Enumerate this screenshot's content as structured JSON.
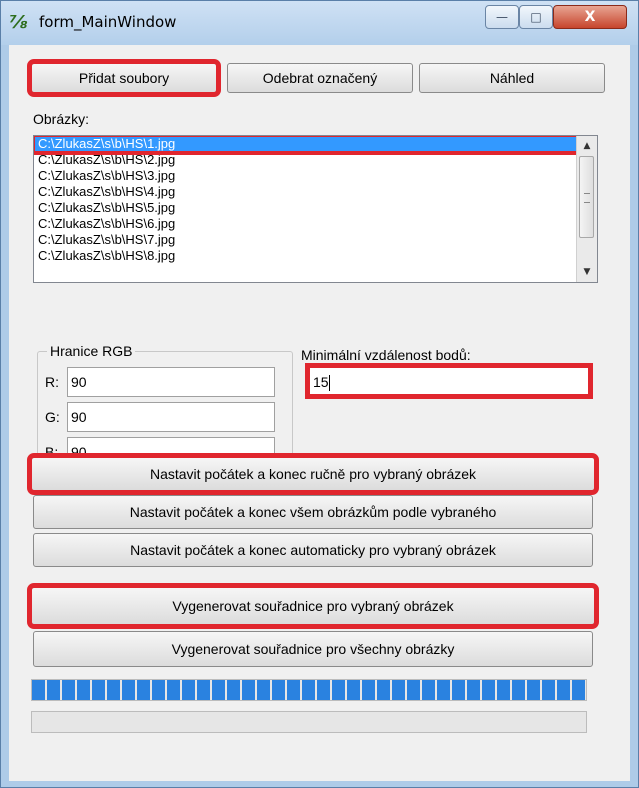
{
  "window": {
    "title": "form_MainWindow",
    "icon": "app-logo-icon"
  },
  "titlebar_buttons": {
    "minimize": "—",
    "maximize": "□",
    "close": "X"
  },
  "toolbar": {
    "add_files": "Přidat soubory",
    "remove_selected": "Odebrat označený",
    "preview": "Náhled"
  },
  "images": {
    "label": "Obrázky:",
    "items": [
      "C:\\ZlukasZ\\s\\b\\HS\\1.jpg",
      "C:\\ZlukasZ\\s\\b\\HS\\2.jpg",
      "C:\\ZlukasZ\\s\\b\\HS\\3.jpg",
      "C:\\ZlukasZ\\s\\b\\HS\\4.jpg",
      "C:\\ZlukasZ\\s\\b\\HS\\5.jpg",
      "C:\\ZlukasZ\\s\\b\\HS\\6.jpg",
      "C:\\ZlukasZ\\s\\b\\HS\\7.jpg",
      "C:\\ZlukasZ\\s\\b\\HS\\8.jpg"
    ],
    "selected_index": 0
  },
  "rgb": {
    "title": "Hranice RGB",
    "r_label": "R:",
    "r_value": "90",
    "g_label": "G:",
    "g_value": "90",
    "b_label": "B:",
    "b_value": "90"
  },
  "min_distance": {
    "label": "Minimální vzdálenost bodů:",
    "value": "15"
  },
  "actions": {
    "set_manual": "Nastavit počátek a konec ručně pro vybraný obrázek",
    "set_all_by_selected": "Nastavit počátek a konec všem obrázkům podle vybraného",
    "set_auto": "Nastavit počátek a konec automaticky pro vybraný obrázek",
    "generate_selected": "Vygenerovat souřadnice pro vybraný obrázek",
    "generate_all": "Vygenerovat souřadnice pro všechny obrázky"
  },
  "progress": {
    "primary_fraction": 1.0,
    "secondary_fraction": 0.0
  },
  "colors": {
    "highlight": "#e0262e",
    "selection": "#3399ff",
    "progress": "#2a82e0"
  }
}
